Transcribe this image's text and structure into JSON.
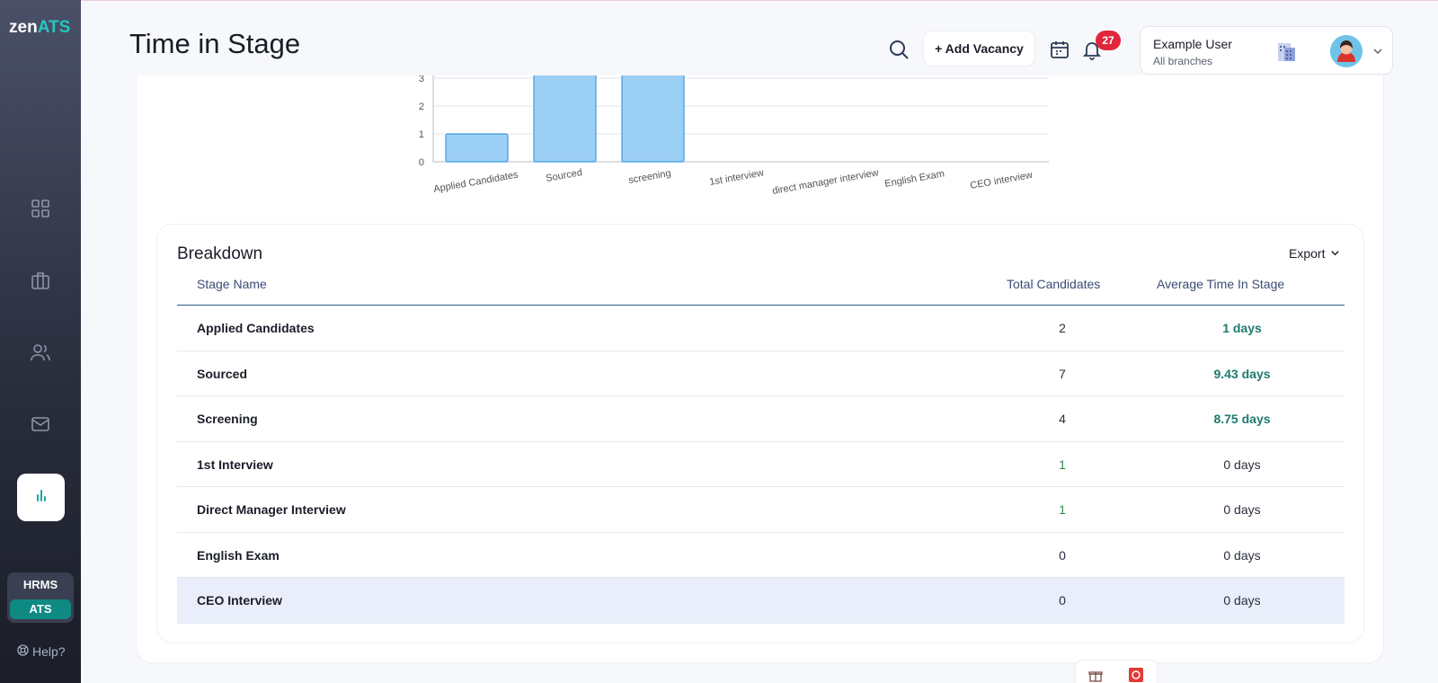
{
  "app": {
    "logo_prefix": "zen",
    "logo_suffix": "ATS"
  },
  "header": {
    "title": "Time in Stage",
    "add_vacancy_label": "+ Add Vacancy",
    "notifications_count": "27",
    "user": {
      "name": "Example User",
      "branch": "All branches"
    }
  },
  "sidebar": {
    "items": [
      "dashboard-icon",
      "briefcase-icon",
      "users-icon",
      "mail-icon",
      "chart-icon"
    ],
    "switcher": {
      "hrms": "HRMS",
      "ats": "ATS"
    },
    "help_label": "Help?"
  },
  "chart_data": {
    "type": "bar",
    "categories": [
      "Applied Candidates",
      "Sourced",
      "screening",
      "1st interview",
      "direct manager interview",
      "English Exam",
      "CEO interview"
    ],
    "values": [
      1,
      9.43,
      8.75,
      0,
      0,
      0,
      0
    ],
    "y_ticks": [
      0,
      1,
      2,
      3
    ],
    "bar_color": "#9ccff4",
    "bar_border": "#3d9be0"
  },
  "breakdown": {
    "title": "Breakdown",
    "export_label": "Export",
    "columns": {
      "stage": "Stage Name",
      "total": "Total Candidates",
      "avg": "Average Time In Stage"
    },
    "rows": [
      {
        "stage": "Applied Candidates",
        "total": "2",
        "avg": "1 days",
        "highlight_avg": true
      },
      {
        "stage": "Sourced",
        "total": "7",
        "avg": "9.43 days",
        "highlight_avg": true
      },
      {
        "stage": "Screening",
        "total": "4",
        "avg": "8.75 days",
        "highlight_avg": true
      },
      {
        "stage": "1st Interview",
        "total": "1",
        "avg": "0 days",
        "highlight_avg": false
      },
      {
        "stage": "Direct Manager Interview",
        "total": "1",
        "avg": "0 days",
        "highlight_avg": false
      },
      {
        "stage": "English Exam",
        "total": "0",
        "avg": "0 days",
        "highlight_avg": false
      },
      {
        "stage": "CEO Interview",
        "total": "0",
        "avg": "0 days",
        "highlight_avg": false
      }
    ]
  }
}
